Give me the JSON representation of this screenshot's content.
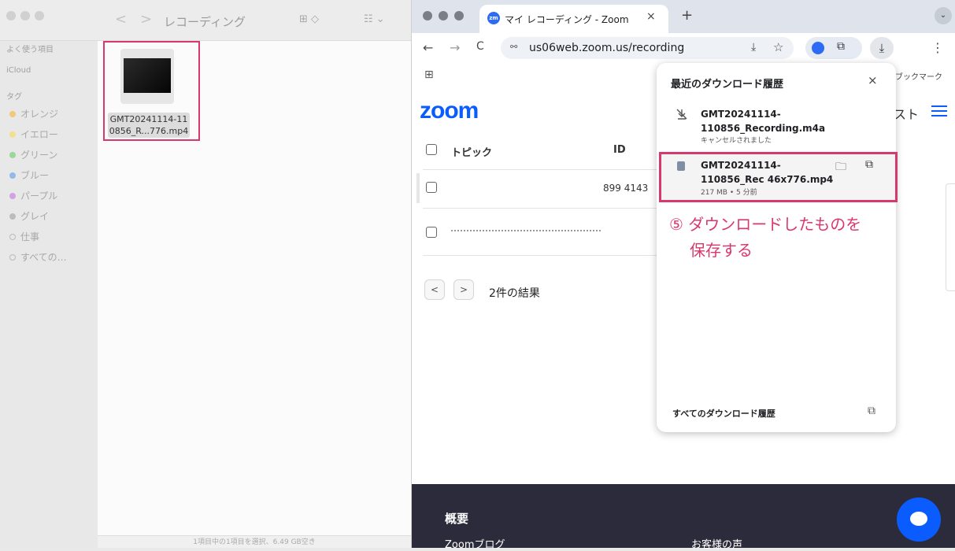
{
  "finder": {
    "title": "レコーディング",
    "nav_back": "<",
    "nav_forward": ">",
    "view_icon": "⊞ ◇",
    "group_icon": "☷ ⌄",
    "sidebar": {
      "favorites_heading": "よく使う項目",
      "icloud_heading": "iCloud",
      "tags_heading": "タグ",
      "tags": [
        {
          "label": "オレンジ",
          "color": "#f5a623"
        },
        {
          "label": "イエロー",
          "color": "#f3d03e"
        },
        {
          "label": "グリーン",
          "color": "#5cc85c"
        },
        {
          "label": "ブルー",
          "color": "#4a90e2"
        },
        {
          "label": "パープル",
          "color": "#b36ad9"
        },
        {
          "label": "グレイ",
          "color": "#999999"
        }
      ],
      "work_tag": "仕事",
      "all_tags": "すべての…"
    },
    "file_name_line1": "GMT20241114-11",
    "file_name_line2": "0856_R...776.mp4",
    "status_bar": "1項目中の1項目を選択、6.49 GB空き"
  },
  "chrome": {
    "tab_title": "マイ レコーディング - Zoom",
    "tab_favicon": "zm",
    "tab_close": "×",
    "new_tab": "+",
    "tab_menu": "⌄",
    "back": "←",
    "forward": "→",
    "reload": "C",
    "site_info": "⚯",
    "url": "us06web.zoom.us/recording",
    "install_icon": "⤓",
    "star_icon": "☆",
    "extensions_icon": "⧉",
    "download_icon": "⤓",
    "menu_icon": "⋮",
    "apps_icon": "⊞",
    "bookmark_label": "ブックマーク"
  },
  "zoom": {
    "logo": "zoom",
    "header_partial": "スト",
    "col_topic": "トピック",
    "col_id": "ID",
    "row1_id": "899 4143",
    "pager_prev": "<",
    "pager_next": ">",
    "results": "2件の結果",
    "footer_title": "概要",
    "footer_blog": "Zoomブログ",
    "footer_voice": "お客様の声"
  },
  "downloads": {
    "title": "最近のダウンロード履歴",
    "close": "×",
    "item1": {
      "name": "GMT20241114-110856_Recording.m4a",
      "status": "キャンセルされました"
    },
    "item2": {
      "name": "GMT20241114-110856_Rec 46x776.mp4",
      "meta": "217 MB • 5 分前"
    },
    "folder_icon": "🗀",
    "open_icon": "⧉",
    "all_history": "すべてのダウンロード履歴",
    "annotation_line1": "⑤ ダウンロードしたものを",
    "annotation_line2": "保存する"
  }
}
